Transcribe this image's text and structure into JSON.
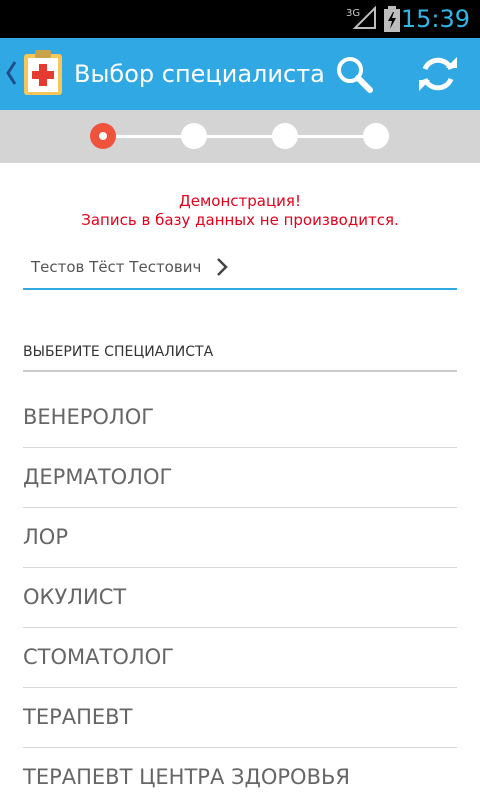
{
  "status_bar": {
    "network_label": "3G",
    "network_icon": "signal-icon",
    "battery_icon": "battery-charging-icon",
    "time": "15:39",
    "time_color": "#33b5e5"
  },
  "action_bar": {
    "title": "Выбор специалиста",
    "back_icon": "chevron-left-icon",
    "app_icon": "medical-clipboard-icon",
    "search_icon": "search-icon",
    "refresh_icon": "refresh-icon",
    "background_color": "#2fa8e4"
  },
  "stepper": {
    "total_steps": 4,
    "current_step": 1,
    "active_color": "#f0533c"
  },
  "demo_notice": {
    "line1": "Демонстрация!",
    "line2": "Запись в базу данных не производится.",
    "color": "#e3001b"
  },
  "patient": {
    "name": "Тестов Тёст Тестович",
    "chevron_icon": "chevron-right-icon"
  },
  "section": {
    "header": "ВЫБЕРИТЕ СПЕЦИАЛИСТА"
  },
  "specialists": [
    {
      "label": "ВЕНЕРОЛОГ"
    },
    {
      "label": "ДЕРМАТОЛОГ"
    },
    {
      "label": "ЛОР"
    },
    {
      "label": "ОКУЛИСТ"
    },
    {
      "label": "СТОМАТОЛОГ"
    },
    {
      "label": "ТЕРАПЕВТ"
    },
    {
      "label": "ТЕРАПЕВТ ЦЕНТРА ЗДОРОВЬЯ"
    }
  ]
}
